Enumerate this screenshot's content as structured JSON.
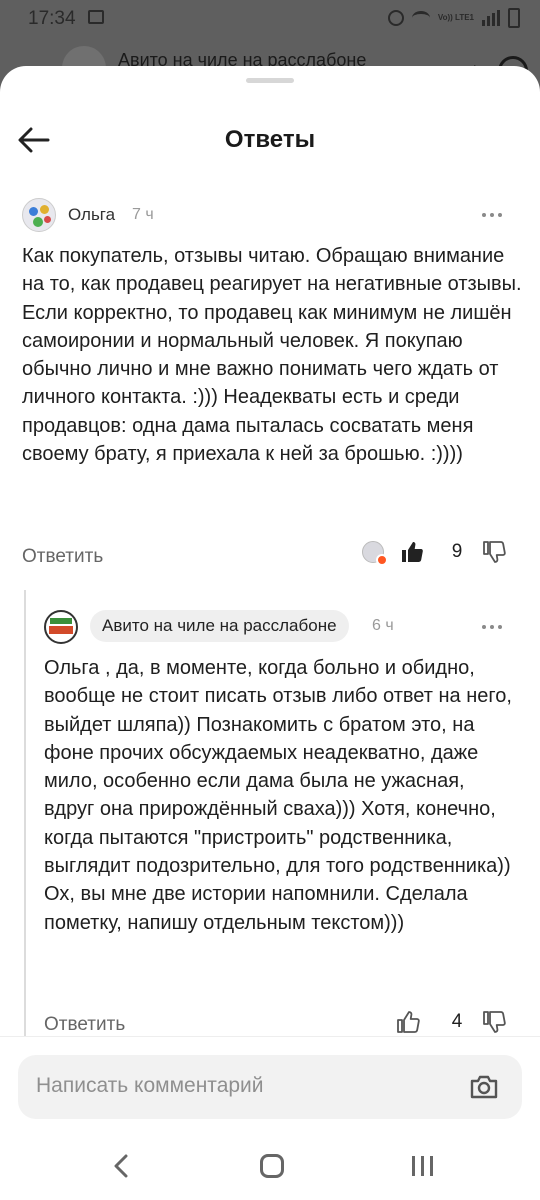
{
  "status_bar": {
    "time": "17:34",
    "network": "Vo)) LTE1"
  },
  "background_header": {
    "title": "Авито на чиле на расслабоне"
  },
  "header": {
    "title": "Ответы"
  },
  "comments": [
    {
      "author": "Ольга",
      "time": "7 ч",
      "text": "Как покупатель, отзывы читаю. Обращаю внимание на то, как продавец реагирует на негативные отзывы. Если корректно, то продавец как минимум не лишён самоиронии и нормальный человек. Я покупаю обычно лично и мне важно понимать чего ждать от личного контакта. :))) Неадекваты есть и среди продавцов: одна дама пыталась сосватать меня своему брату, я приехала к ней за брошью. :))))",
      "reply_label": "Ответить",
      "likes": "9"
    },
    {
      "author": "Авито на чиле на расслабоне",
      "time": "6 ч",
      "text": "Ольга , да, в моменте, когда больно и обидно, вообще не стоит писать отзыв либо ответ на него, выйдет шляпа)) Познакомить с братом это, на фоне прочих обсуждаемых неадекватно, даже мило, особенно если дама была не ужасная, вдруг она прирождённый сваха))) Хотя, конечно, когда пытаются \"пристроить\" родственника, выглядит подозрительно, для того родственника)) Ох, вы мне две истории напомнили. Сделала пометку, напишу отдельным текстом)))",
      "reply_label": "Ответить",
      "likes": "4"
    }
  ],
  "composer": {
    "placeholder": "Написать комментарий"
  },
  "colors": {
    "accent": "#ff5722",
    "text": "#1f1f1f",
    "muted": "#9a9a9a"
  }
}
